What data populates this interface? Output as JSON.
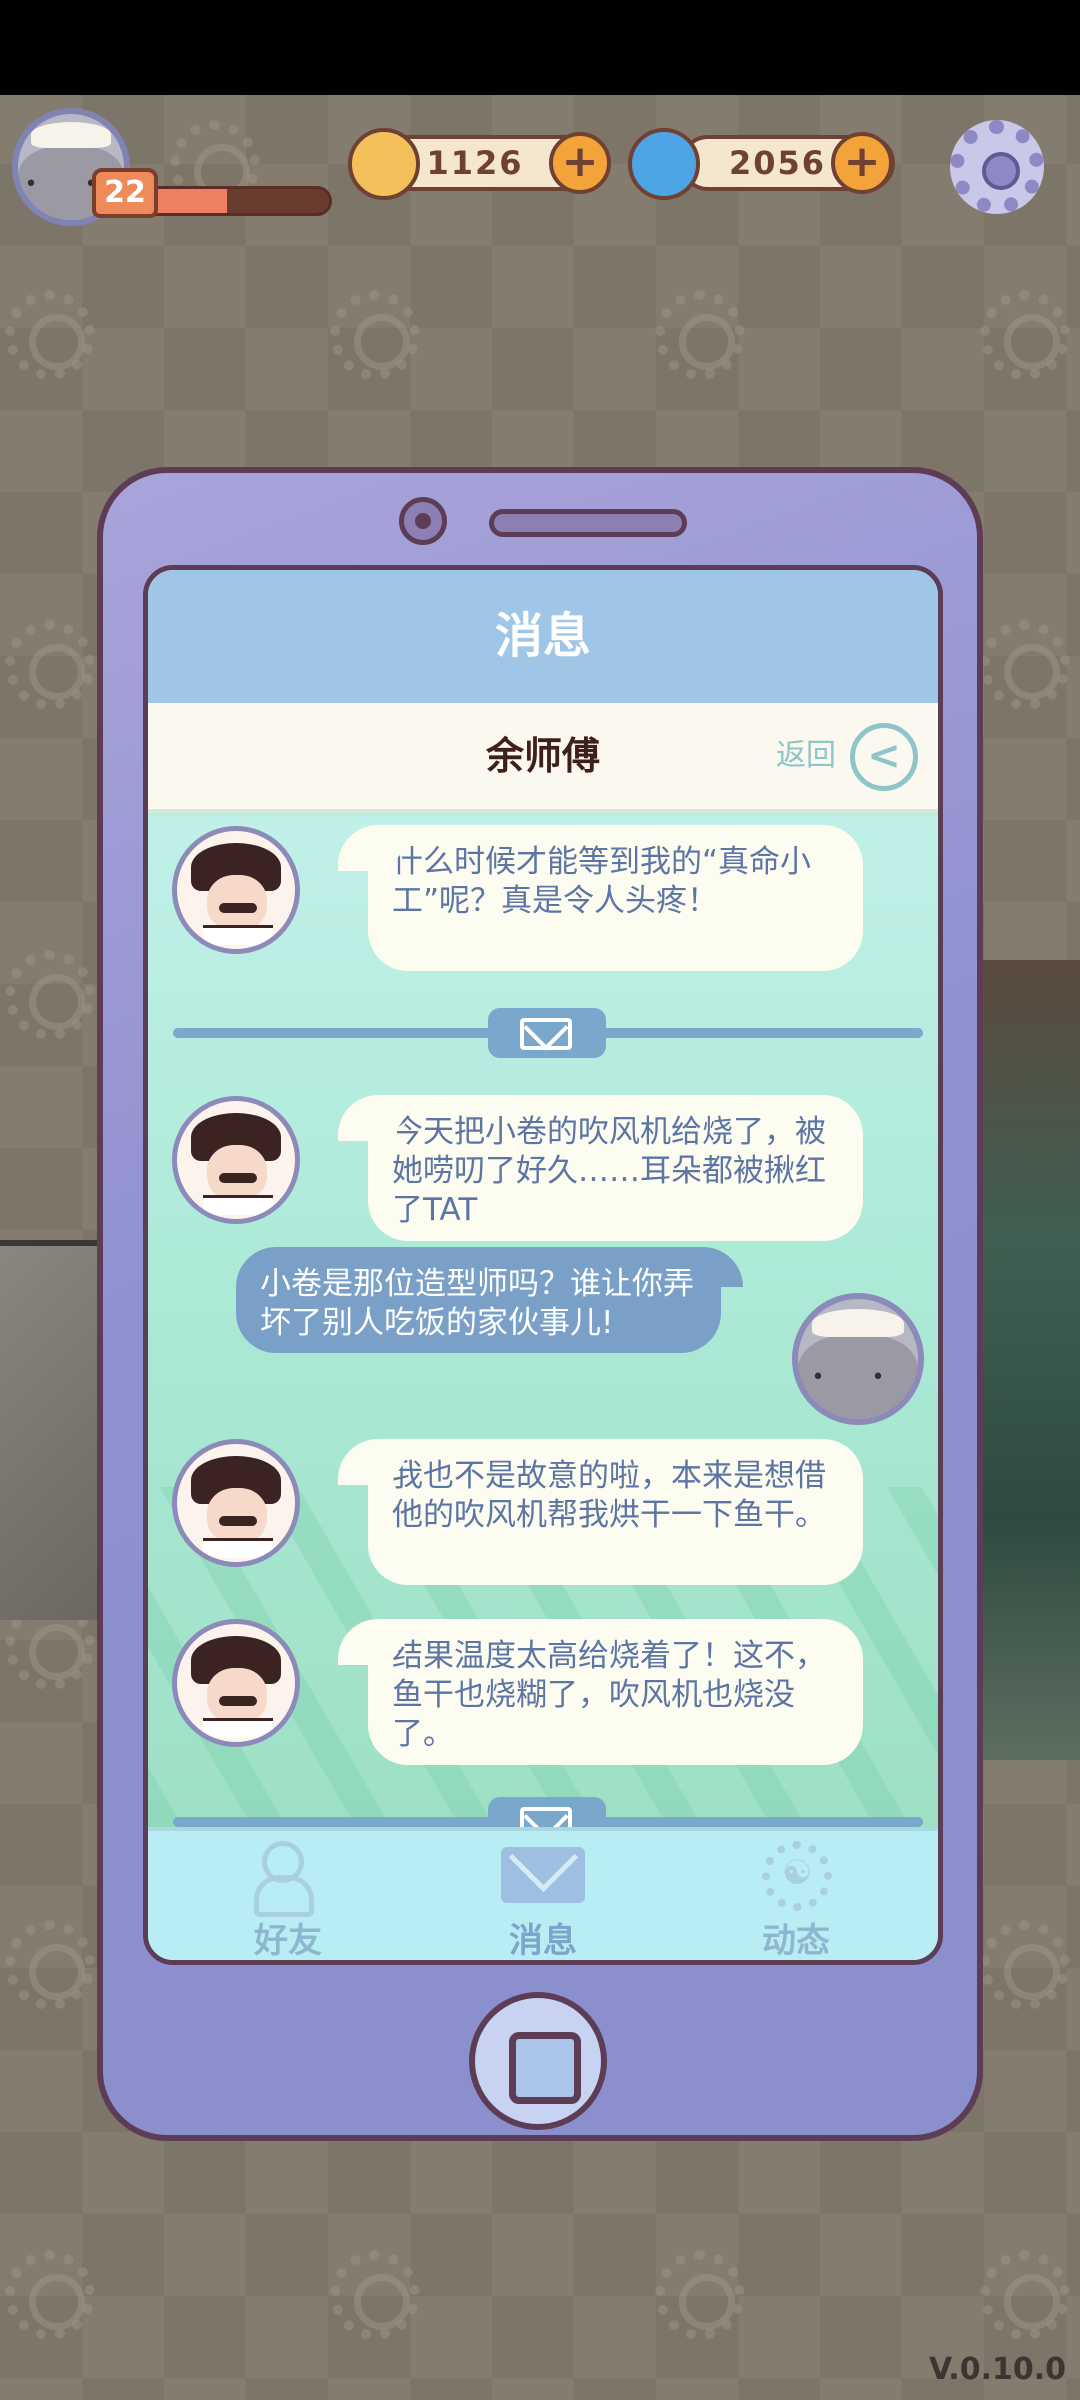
{
  "hud": {
    "player_level": "22",
    "xp_progress": 0.45,
    "coins": "1126",
    "gems": "2056"
  },
  "phone": {
    "title": "消息",
    "contact_name": "余师傅",
    "back_label": "返回",
    "messages": [
      {
        "sender": "余师傅",
        "text": "什么时候才能等到我的“真命小工”呢？真是令人头疼！"
      },
      {
        "sender": "余师傅",
        "text": "今天把小卷的吹风机给烧了，被她唠叨了好久……耳朵都被揪红了TAT"
      },
      {
        "sender": "me",
        "text": "小卷是那位造型师吗？谁让你弄坏了别人吃饭的家伙事儿!"
      },
      {
        "sender": "余师傅",
        "text": "我也不是故意的啦，本来是想借他的吹风机帮我烘干一下鱼干。"
      },
      {
        "sender": "余师傅",
        "text": "结果温度太高给烧着了！这不，鱼干也烧糊了，吹风机也烧没了。"
      }
    ],
    "tabs": [
      {
        "label": "好友",
        "icon": "friends-icon"
      },
      {
        "label": "消息",
        "icon": "mail-icon"
      },
      {
        "label": "动态",
        "icon": "moments-icon"
      }
    ]
  },
  "version": "V.0.10.0",
  "colors": {
    "phone_body": "#8e90d0",
    "screen_header": "#9fc6e6",
    "my_bubble": "#7aa0c7",
    "npc_bubble_text": "#5c75a5"
  }
}
